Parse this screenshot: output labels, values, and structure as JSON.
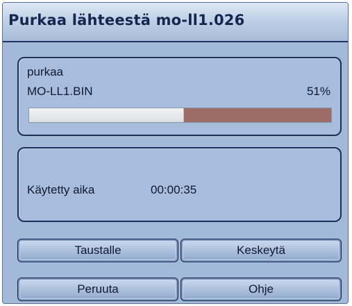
{
  "window": {
    "title": "Purkaa lähteestä mo-ll1.026"
  },
  "progress": {
    "action_label": "purkaa",
    "file_name": "MO-LL1.BIN",
    "percent_label": "51%",
    "fraction": 0.51
  },
  "time": {
    "label": "Käytetty aika",
    "value": "00:00:35"
  },
  "buttons": {
    "background": "Taustalle",
    "pause": "Keskeytä",
    "cancel": "Peruuta",
    "help": "Ohje"
  },
  "colors": {
    "background": "#a2b9d7",
    "progress_done": "#e9eaec",
    "progress_remaining": "#9d6c66",
    "border": "#1c2f59"
  }
}
